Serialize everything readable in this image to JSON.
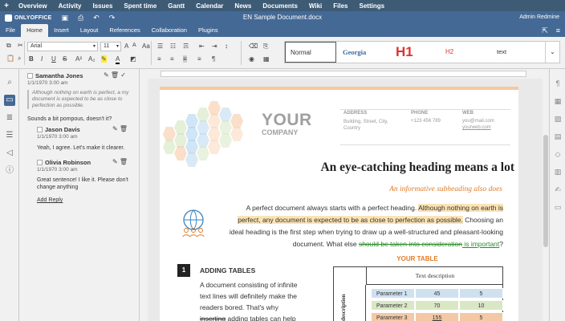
{
  "topnav": {
    "items": [
      "Overview",
      "Activity",
      "Issues",
      "Spent time",
      "Gantt",
      "Calendar",
      "News",
      "Documents",
      "Wiki",
      "Files",
      "Settings"
    ]
  },
  "titlebar": {
    "logo": "ONLYOFFICE",
    "doc_title": "EN Sample Document.docx",
    "user": "Admin Redmine"
  },
  "tabs": [
    "File",
    "Home",
    "Insert",
    "Layout",
    "References",
    "Collaboration",
    "Plugins"
  ],
  "toolbar": {
    "font": "Arial",
    "size": "11",
    "styles": [
      "Normal",
      "Georgia",
      "H1",
      "H2",
      "text"
    ]
  },
  "comments": [
    {
      "author": "Samantha Jones",
      "date": "1/1/1970 3:00 am",
      "quote": "Although nothing on earth is perfect, a my document is expected to be as close to perfection as possible.",
      "text": "Sounds a bit pompous, doesn't it?"
    },
    {
      "author": "Jason Davis",
      "date": "1/1/1970 3:00 am",
      "text": "Yeah, I agree. Let's make it clearer."
    },
    {
      "author": "Olivia Robinson",
      "date": "1/1/1970 3:00 am",
      "text": "Great sentence! I like it. Please don't change anything"
    }
  ],
  "add_reply": "Add Reply",
  "document": {
    "your": "YOUR",
    "company": "COMPANY",
    "address_label": "ADDRESS",
    "address": "Building, Street, City, Country",
    "phone_label": "PHONE",
    "phone": "+123 456 789",
    "web_label": "WEB",
    "email": "you@mail.com",
    "web": "yourweb.com",
    "heading": "An eye-catching heading means a lot",
    "subheading": "An informative subheading also does",
    "p1_a": "A perfect document always starts with a perfect heading. ",
    "p1_b": "Although nothing on earth is perfect, any document is expected to be as close to perfection as possible.",
    "p2_a": " Choosing an ideal heading is the first step when trying to draw up a well-structured and pleasant-looking document. What else ",
    "p2_del": "should be taken into consideration",
    "p2_ins": " is important",
    "p2_end": "?",
    "section_num": "1",
    "section_title": "ADDING TABLES",
    "section_body_a": "A document consisting of infinite text lines will definitely make the readers bored. That's why ",
    "section_body_del": "inserting",
    "section_body_b": " adding tables can help",
    "table_title": "YOUR TABLE",
    "table_header": "Text description",
    "table_side": "description",
    "table_rows": [
      [
        "Parameter 1",
        "45",
        "5"
      ],
      [
        "Parameter 2",
        "70",
        "10"
      ],
      [
        "Parameter 3",
        "155",
        "5"
      ]
    ]
  },
  "colors": {
    "accent": "#446995",
    "orange": "#e07b28",
    "table_blue": "#cfe0ef",
    "table_green": "#d9e7c5",
    "table_orange": "#f3c9a5"
  }
}
